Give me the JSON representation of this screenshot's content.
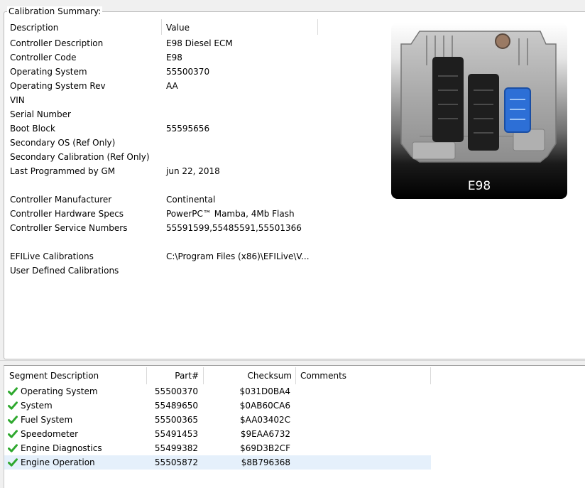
{
  "summary": {
    "group_title": "Calibration Summary:",
    "col_description": "Description",
    "col_value": "Value",
    "rows": [
      {
        "desc": "Controller Description",
        "val": "E98 Diesel ECM"
      },
      {
        "desc": "Controller Code",
        "val": "E98"
      },
      {
        "desc": "Operating System",
        "val": "55500370"
      },
      {
        "desc": "Operating System Rev",
        "val": "AA"
      },
      {
        "desc": "VIN",
        "val": ""
      },
      {
        "desc": "Serial Number",
        "val": ""
      },
      {
        "desc": "Boot Block",
        "val": "55595656"
      },
      {
        "desc": "Secondary OS (Ref Only)",
        "val": ""
      },
      {
        "desc": "Secondary Calibration (Ref Only)",
        "val": ""
      },
      {
        "desc": "Last Programmed by GM",
        "val": "jun 22, 2018"
      },
      {
        "desc": "Controller Manufacturer",
        "val": "Continental"
      },
      {
        "desc": "Controller Hardware Specs",
        "val": "PowerPC™ Mamba, 4Mb Flash"
      },
      {
        "desc": "Controller Service Numbers",
        "val": "55591599,55485591,55501366"
      },
      {
        "desc": "EFILive Calibrations",
        "val": "C:\\Program Files (x86)\\EFILive\\V..."
      },
      {
        "desc": "User Defined Calibrations",
        "val": ""
      }
    ]
  },
  "ecm_image": {
    "label": "E98",
    "connector_colors": [
      "#1e1e1e",
      "#1e1e1e",
      "#2d6fd6"
    ]
  },
  "segments": {
    "headers": {
      "segment_description": "Segment Description",
      "part": "Part#",
      "checksum": "Checksum",
      "comments": "Comments"
    },
    "status_icon": "green-check-icon",
    "check_color": "#2ea82e",
    "rows": [
      {
        "name": "Operating System",
        "part": "55500370",
        "checksum": "$031D0BA4",
        "selected": false
      },
      {
        "name": "System",
        "part": "55489650",
        "checksum": "$0AB60CA6",
        "selected": false
      },
      {
        "name": "Fuel System",
        "part": "55500365",
        "checksum": "$AA03402C",
        "selected": false
      },
      {
        "name": "Speedometer",
        "part": "55491453",
        "checksum": "$9EAA6732",
        "selected": false
      },
      {
        "name": "Engine Diagnostics",
        "part": "55499382",
        "checksum": "$69D3B2CF",
        "selected": false
      },
      {
        "name": "Engine Operation",
        "part": "55505872",
        "checksum": "$8B796368",
        "selected": true
      }
    ]
  }
}
